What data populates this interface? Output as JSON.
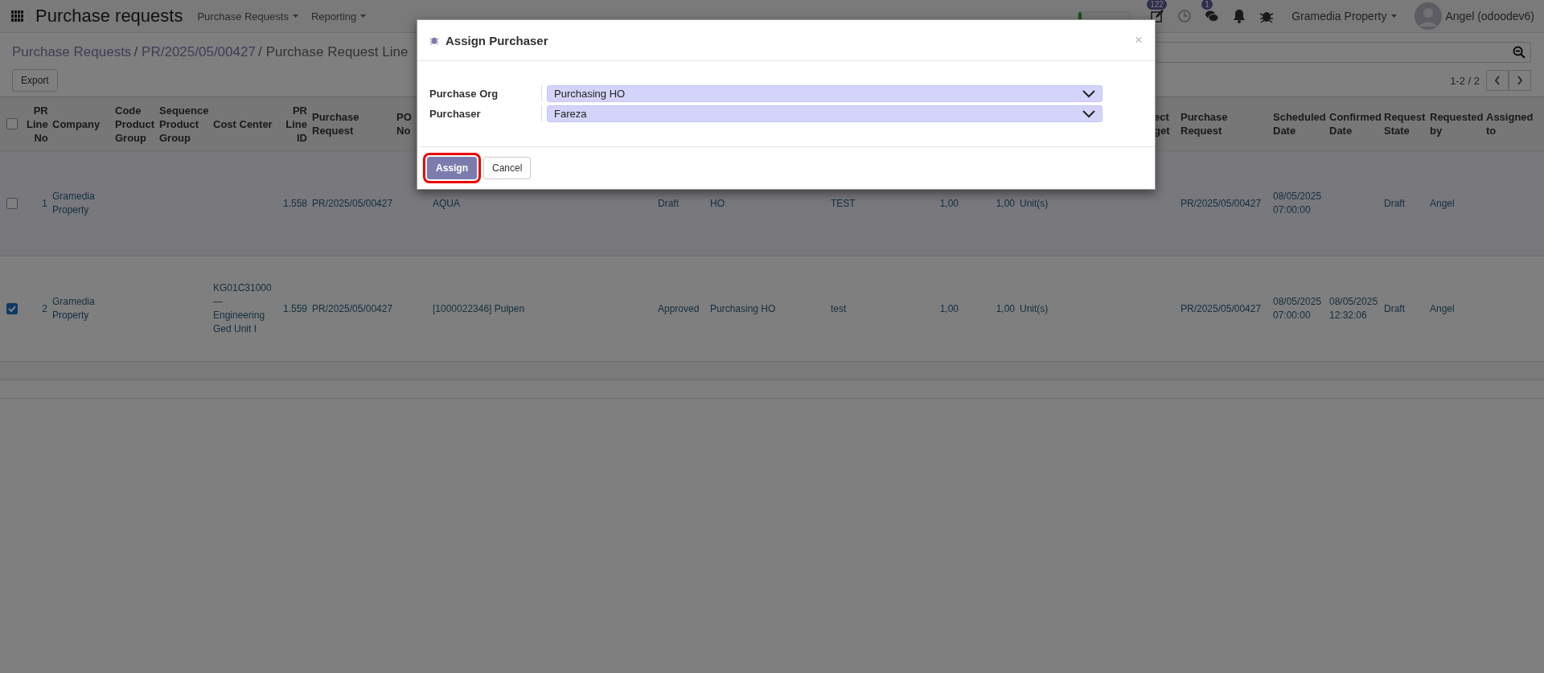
{
  "navbar": {
    "app_title": "Purchase requests",
    "menus": [
      {
        "label": "Purchase Requests"
      },
      {
        "label": "Reporting"
      }
    ],
    "progress": {
      "level": 0.06
    },
    "activity_badge": "122",
    "message_badge": "1",
    "company": "Gramedia Property",
    "user": "Angel (odoodev6)"
  },
  "breadcrumb": {
    "separator": "/",
    "items": [
      "Purchase Requests",
      "PR/2025/05/00427",
      "Purchase Request Line"
    ]
  },
  "export_button": "Export",
  "pager": "1-2 / 2",
  "table": {
    "select_all": {
      "checked": false
    },
    "columns": [
      {
        "label": "PR Line No"
      },
      {
        "label": "Company"
      },
      {
        "label": "Code Product Group"
      },
      {
        "label": "Sequence Product Group"
      },
      {
        "label": "Cost Center"
      },
      {
        "label": "PR Line ID"
      },
      {
        "label": "Purchase Request"
      },
      {
        "label": "PO No"
      },
      {},
      {},
      {},
      {},
      {},
      {},
      {},
      {
        "label": "ect get"
      },
      {
        "label": "Purchase Request"
      },
      {
        "label": "Scheduled Date"
      },
      {
        "label": "Confirmed Date"
      },
      {
        "label": "Request State"
      },
      {
        "label": "Requested by"
      },
      {
        "label": "Assigned to"
      }
    ],
    "rows": [
      {
        "checked": false,
        "cells": [
          "1",
          "Gramedia Property",
          null,
          null,
          null,
          "1.558",
          "PR/2025/05/00427",
          null,
          "AQUA",
          "Draft",
          "HO",
          "TEST",
          "1,00",
          "1,00",
          "Unit(s)",
          null,
          "PR/2025/05/00427",
          "08/05/2025 07:00:00",
          null,
          "Draft",
          "Angel",
          null
        ]
      },
      {
        "checked": true,
        "cells": [
          "2",
          "Gramedia Property",
          null,
          null,
          "KG01C31000 — Engineering Ged Unit I",
          "1.559",
          "PR/2025/05/00427",
          null,
          "[1000022346] Pulpen",
          "Approved",
          "Purchasing HO",
          "test",
          "1,00",
          "1,00",
          "Unit(s)",
          null,
          "PR/2025/05/00427",
          "08/05/2025 07:00:00",
          "08/05/2025 12:32:06",
          "Draft",
          "Angel",
          null
        ]
      }
    ]
  },
  "dialog": {
    "title": "Assign Purchaser",
    "close": "×",
    "fields": [
      {
        "label": "Purchase Org",
        "value": "Purchasing HO"
      },
      {
        "label": "Purchaser",
        "value": "Fareza"
      }
    ],
    "buttons": [
      {
        "label": "Assign",
        "kind": "primary",
        "highlighted": true
      },
      {
        "label": "Cancel",
        "kind": "secondary",
        "highlighted": false
      }
    ]
  }
}
